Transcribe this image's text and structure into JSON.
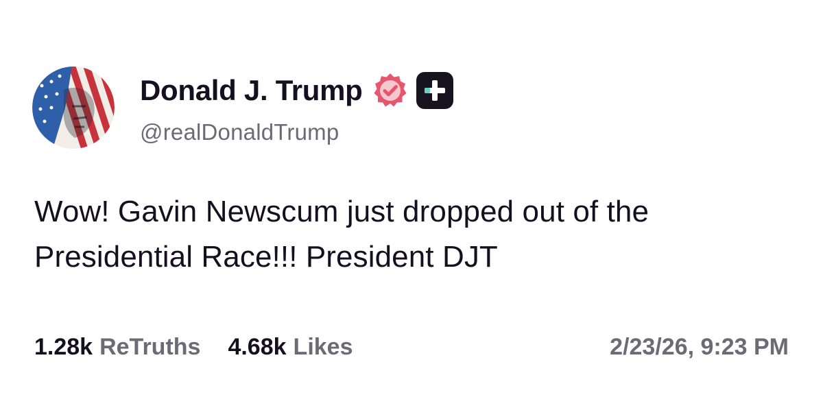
{
  "author": {
    "display_name": "Donald J. Trump",
    "handle": "@realDonaldTrump",
    "avatar_icon": "flag-portrait-avatar",
    "verified_icon": "verified-badge-icon",
    "plus_icon": "truth-plus-icon"
  },
  "post": {
    "text": "Wow! Gavin Newscum just dropped out of the Presidential Race!!! President DJT"
  },
  "stats": {
    "retruths_count": "1.28k",
    "retruths_label": "ReTruths",
    "likes_count": "4.68k",
    "likes_label": "Likes"
  },
  "timestamp": "2/23/26, 9:23 PM",
  "colors": {
    "text": "#14101f",
    "muted": "#6b6a75",
    "verified_pink": "#e5566f",
    "plus_bg": "#17141f",
    "plus_accent": "#5fd3c5"
  }
}
